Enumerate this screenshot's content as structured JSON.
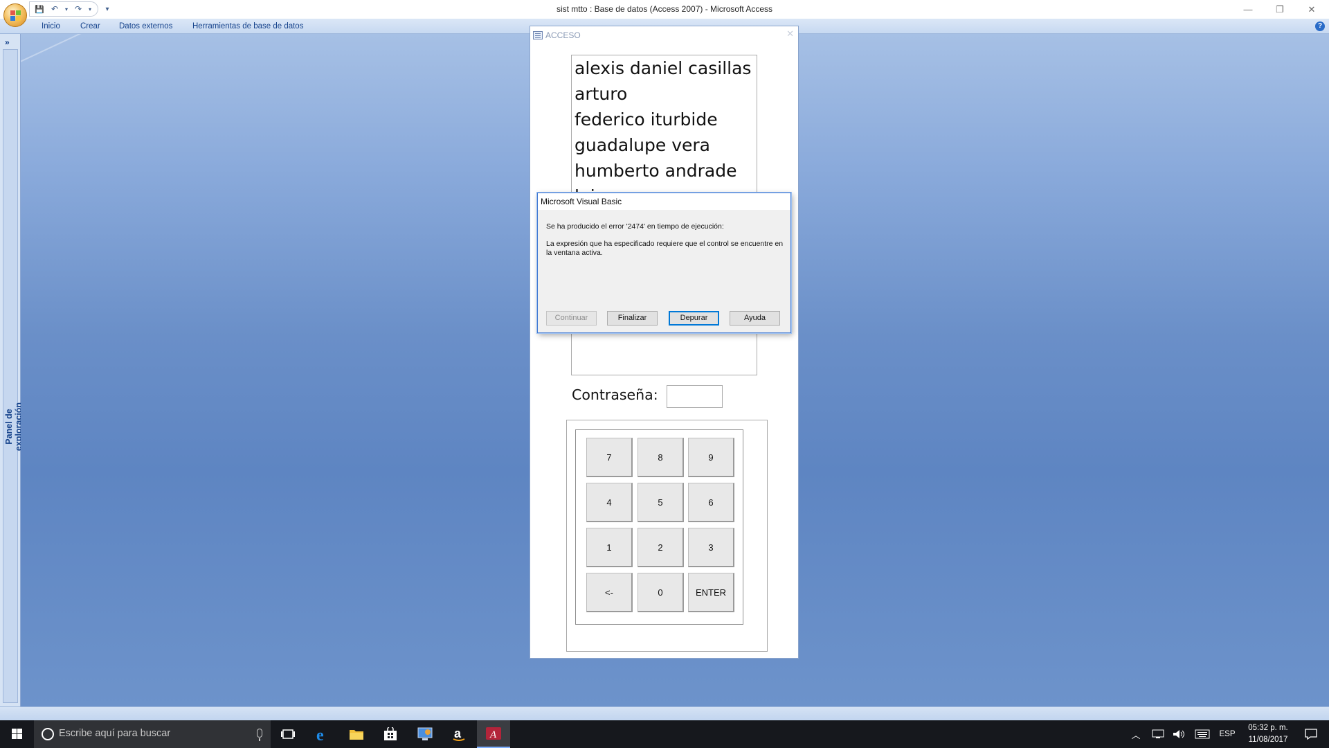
{
  "window": {
    "title": "sist mtto : Base de datos (Access 2007) - Microsoft Access",
    "minimize": "—",
    "restore": "❐",
    "close": "✕"
  },
  "qat": {
    "save": "💾",
    "undo": "↶",
    "redo": "↷",
    "customize": "▾"
  },
  "ribbon": {
    "tabs": [
      "Inicio",
      "Crear",
      "Datos externos",
      "Herramientas de base de datos"
    ],
    "help": "?"
  },
  "nav_pane": {
    "toggle": "»",
    "label": "Panel de exploración"
  },
  "form": {
    "title": "ACCESO",
    "close": "✕",
    "users": [
      "alexis daniel casillas",
      "arturo",
      "federico iturbide",
      "guadalupe vera",
      "humberto andrade",
      "luis"
    ],
    "password_label": "Contraseña:",
    "password_value": "",
    "keys": [
      "7",
      "8",
      "9",
      "4",
      "5",
      "6",
      "1",
      "2",
      "3",
      "<-",
      "0",
      "ENTER"
    ]
  },
  "dialog": {
    "title": "Microsoft Visual Basic",
    "message1": "Se ha producido el error '2474' en tiempo de ejecución:",
    "message2": "La expresión que ha especificado requiere que el control se encuentre en la ventana activa.",
    "buttons": {
      "continue": "Continuar",
      "end": "Finalizar",
      "debug": "Depurar",
      "help": "Ayuda"
    }
  },
  "taskbar": {
    "search_placeholder": "Escribe aquí para buscar",
    "language": "ESP",
    "time": "05:32 p. m.",
    "date": "11/08/2017"
  },
  "colors": {
    "accent": "#0078d7",
    "ribbon_text": "#15428b",
    "taskbar": "#16181d",
    "workspace": "#6a8fc8"
  }
}
